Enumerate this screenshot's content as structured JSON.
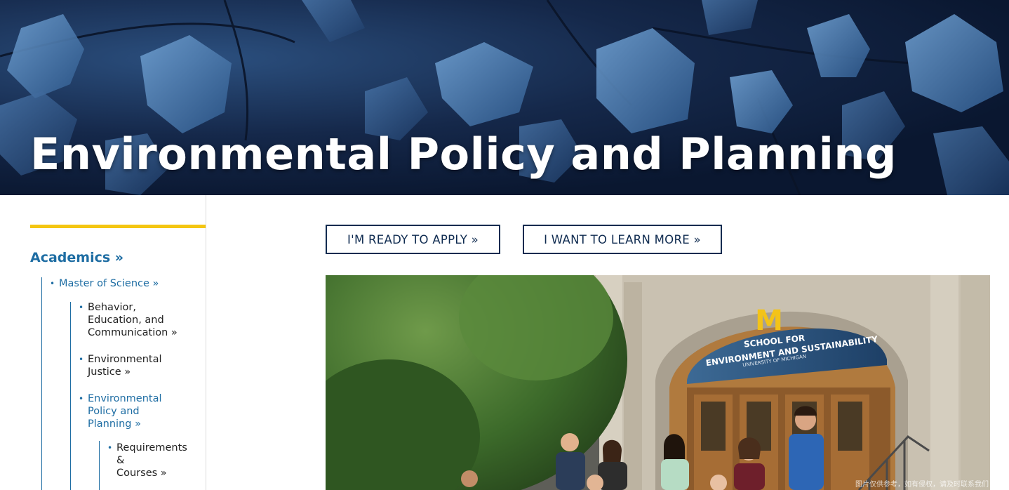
{
  "hero": {
    "title": "Environmental Policy and Planning"
  },
  "sidebar": {
    "top_link": "Academics »",
    "level1": {
      "label": "Master of Science »"
    },
    "level2": [
      {
        "label": "Behavior, Education, and Communication »",
        "lines": [
          "Behavior,",
          "Education, and",
          "Communication »"
        ]
      },
      {
        "label": "Environmental Justice »",
        "lines": [
          "Environmental",
          "Justice »"
        ]
      },
      {
        "label": "Environmental Policy and Planning »",
        "lines": [
          "Environmental",
          "Policy and",
          "Planning »"
        ]
      }
    ],
    "level3": {
      "label": "Requirements & Courses »",
      "lines": [
        "Requirements",
        "&",
        "Courses »"
      ]
    }
  },
  "buttons": {
    "apply": "I'M READY TO APPLY »",
    "learn": "I WANT TO LEARN MORE »"
  },
  "photo": {
    "building_sign_logo": "M",
    "building_sign_line1": "SCHOOL FOR",
    "building_sign_line2": "ENVIRONMENT AND SUSTAINABILITY",
    "building_sign_line3": "UNIVERSITY OF MICHIGAN",
    "watermark": "图片仅供参考，如有侵权，请及时联系我们",
    "colors": {
      "maize": "#FFCB05",
      "blue": "#00274C"
    }
  },
  "theme": {
    "accent": "#1e6da3",
    "navy": "#0f2b50",
    "maize_bar": "#f4c612"
  }
}
